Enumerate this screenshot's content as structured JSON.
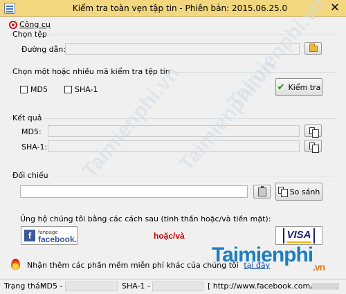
{
  "window": {
    "title": "Kiểm tra toàn vẹn tập tin - Phiên bản: 2015.06.25.0",
    "close_glyph": "✕"
  },
  "menu": {
    "tools_label": "Công cụ"
  },
  "file_group": {
    "title": "Chọn tệp",
    "path_label": "Đường dẫn:",
    "path_value": ""
  },
  "check_group": {
    "title": "Chọn một hoặc nhiều mã kiểm tra tệp tin",
    "md5_label": "MD5",
    "md5_checked": false,
    "sha1_label": "SHA-1",
    "sha1_checked": false,
    "check_button": "Kiểm tra"
  },
  "result_group": {
    "title": "Kết quả",
    "md5_label": "MD5:",
    "md5_value": "",
    "sha1_label": "SHA-1:",
    "sha1_value": ""
  },
  "compare_group": {
    "title": "Đối chiếu",
    "compare_value": "",
    "compare_button": "So sánh"
  },
  "support_group": {
    "title": "Ủng hộ chúng tôi bằng các cách sau (tinh thần hoặc/và tiền mặt):",
    "facebook_small": "fanpage",
    "facebook_big": "facebook.",
    "facebook_f": "f",
    "or_text": "hoặc/và",
    "visa_text": "VISA"
  },
  "promo": {
    "text": "Nhận thêm các phần mềm miễn phí khác của chúng tôi",
    "link": "tại đây"
  },
  "status": {
    "label": "Trạng thái:",
    "md5": "MD5 -",
    "sha1": "SHA-1 -",
    "facebook": "[ http://www.facebook.com/"
  },
  "watermark": {
    "text": "Taimienphi.vn",
    "logo_main": "Taimienphi",
    "logo_domain": ".vn"
  },
  "colors": {
    "titlebar": "#f2d77e",
    "facebook": "#3b5998",
    "visa": "#1a1f71",
    "or_text": "#c00000",
    "link": "#0645ad"
  }
}
